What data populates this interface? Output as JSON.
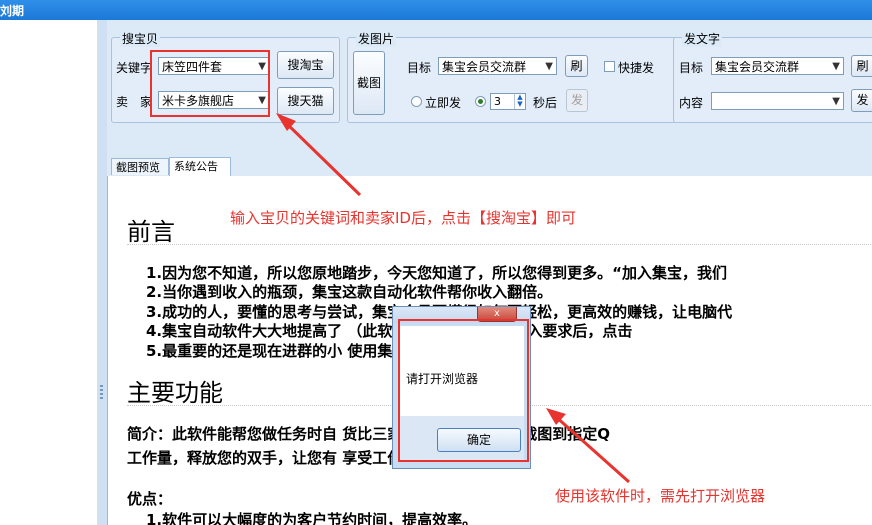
{
  "window": {
    "title": "刘期"
  },
  "colors": {
    "accent_red": "#e8332e",
    "title_blue": "#1c78d8"
  },
  "search_group": {
    "label": "搜宝贝",
    "keyword_label": "关键字",
    "keyword_value": "床笠四件套",
    "seller_label": "卖　家",
    "seller_value": "米卡多旗舰店",
    "search_taobao_btn": "搜淘宝",
    "search_tmall_btn": "搜天猫"
  },
  "image_group": {
    "label": "发图片",
    "screenshot_btn": "截图",
    "target_label": "目标",
    "target_value": "集宝会员交流群",
    "refresh_btn": "刷",
    "quick_send_label": "快捷发",
    "send_now_label": "立即发",
    "interval_value": "3",
    "seconds_label": "秒后",
    "send_btn": "发"
  },
  "text_group": {
    "label": "发文字",
    "target_label": "目标",
    "target_value": "集宝会员交流群",
    "refresh_btn": "刷",
    "content_label": "内容",
    "content_value": "",
    "send_btn": "发"
  },
  "tabs": [
    {
      "label": "截图预览"
    },
    {
      "label": "系统公告"
    }
  ],
  "notice": {
    "heading_preface": "前言",
    "preface_lines": [
      "1.因为您不知道，所以您原地踏步，今天您知道了，所以您得到更多。“加入集宝，我们",
      "2.当你遇到收入的瓶颈，集宝这款自动化软件帮你收入翻倍。",
      "3.成功的人，要懂的思考与尝试，集宝会员更懂得如何更轻松，更高效的赚钱，让电脑代",
      "4.集宝自动软件大大地提高了                    （此软件为浏览器插件，输入要求后，点击",
      "5.最重要的还是现在进群的小                    使用集宝自动软件。"
    ],
    "heading_features": "主要功能",
    "intro_line1": "简介：此软件能帮您做任务时自                    货比三家，并可以自动发送截图到指定Q",
    "intro_line2": "工作量，释放您的双手，让您有                    享受工作的乐趣！",
    "advantages_label": "优点：",
    "advantage_1": "1.软件可以大幅度的为客户节约时间，提高效率。"
  },
  "annotations": {
    "search_tip": "输入宝贝的关键词和卖家ID后，点击【搜淘宝】即可",
    "browser_tip": "使用该软件时，需先打开浏览器"
  },
  "dialog": {
    "close_glyph": "x",
    "message": "请打开浏览器",
    "ok_btn": "确定"
  }
}
